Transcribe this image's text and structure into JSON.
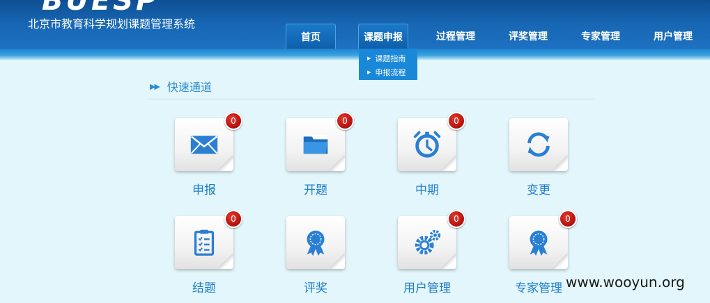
{
  "header": {
    "logo_text": "BUESP",
    "system_title": "北京市教育科学规划课题管理系统"
  },
  "nav": {
    "items": [
      {
        "label": "首页"
      },
      {
        "label": "课题申报"
      },
      {
        "label": "过程管理"
      },
      {
        "label": "评奖管理"
      },
      {
        "label": "专家管理"
      },
      {
        "label": "用户管理"
      }
    ],
    "active_index": 0,
    "hover_index": 1,
    "dropdown": [
      {
        "label": "课题指南"
      },
      {
        "label": "申报流程"
      }
    ]
  },
  "quick": {
    "title": "快速通道",
    "arrow_icon": "double-right-arrow-icon",
    "tiles": [
      {
        "label": "申报",
        "icon": "envelope-icon",
        "badge": "0"
      },
      {
        "label": "开题",
        "icon": "folder-icon",
        "badge": "0"
      },
      {
        "label": "中期",
        "icon": "alarm-clock-icon",
        "badge": "0"
      },
      {
        "label": "变更",
        "icon": "refresh-icon",
        "badge": ""
      },
      {
        "label": "结题",
        "icon": "clipboard-checklist-icon",
        "badge": "0"
      },
      {
        "label": "评奖",
        "icon": "award-ribbon-icon",
        "badge": ""
      },
      {
        "label": "用户管理",
        "icon": "gears-icon",
        "badge": "0"
      },
      {
        "label": "专家管理",
        "icon": "award-ribbon-icon",
        "badge": "0"
      }
    ]
  },
  "watermark": "www.wooyun.org",
  "colors": {
    "header_dark": "#0e4f93",
    "header_light": "#1d73c2",
    "page_bg": "#e3f6fb",
    "label_blue": "#1f7ec9",
    "badge_red": "#b20f0c",
    "icon_blue": "#2a7fd4"
  }
}
